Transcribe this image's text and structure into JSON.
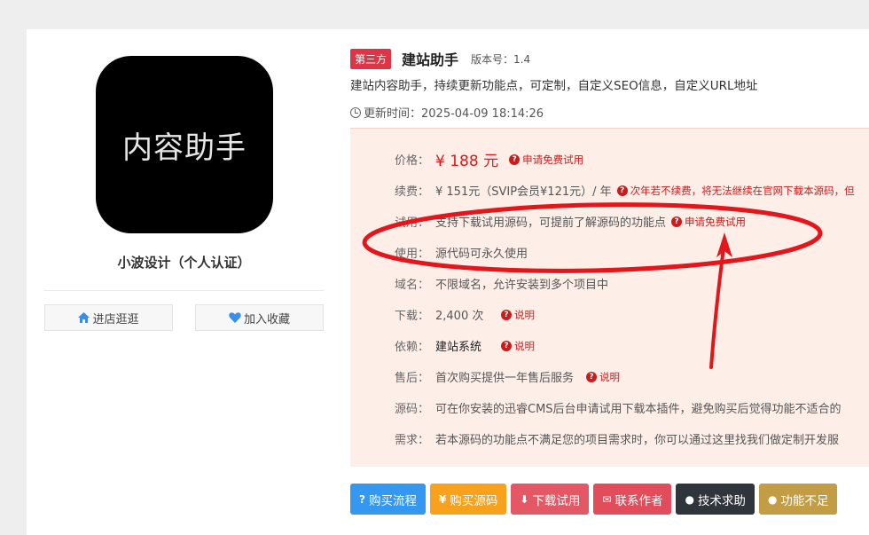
{
  "sidebar": {
    "logo_text": "内容助手",
    "author": "小波设计（个人认证）",
    "buttons": {
      "shop": "进店逛逛",
      "favorite": "加入收藏"
    }
  },
  "header": {
    "badge": "第三方",
    "title": "建站助手",
    "version": "版本号：1.4",
    "description": "建站内容助手，持续更新功能点，可定制，自定义SEO信息，自定义URL地址",
    "update_time": "更新时间：2025-04-09 18:14:26"
  },
  "info": {
    "price": {
      "label": "价格：",
      "value": "¥ 188 元",
      "tip": "申请免费试用"
    },
    "renewal": {
      "label": "续费：",
      "value": "¥ 151元（SVIP会员¥121元）/ 年",
      "tip": "次年若不续费，将无法继续在官网下载本源码，但"
    },
    "trial": {
      "label": "试用：",
      "value": "支持下载试用源码，可提前了解源码的功能点",
      "tip": "申请免费试用"
    },
    "usage": {
      "label": "使用：",
      "value": "源代码可永久使用"
    },
    "domain": {
      "label": "域名：",
      "value": "不限域名，允许安装到多个项目中"
    },
    "downloads": {
      "label": "下载：",
      "value": "2,400 次",
      "tip": "说明"
    },
    "depends": {
      "label": "依赖：",
      "value": "建站系统",
      "tip": "说明"
    },
    "aftersale": {
      "label": "售后：",
      "value": "首次购买提供一年售后服务",
      "tip": "说明"
    },
    "source": {
      "label": "源码：",
      "value": "可在你安装的迅睿CMS后台申请试用下载本插件，避免购买后觉得功能不适合的"
    },
    "demand": {
      "label": "需求：",
      "value": "若本源码的功能点不满足您的项目需求时，你可以通过这里找我们做定制开发服"
    }
  },
  "actions": [
    {
      "label": "购买流程",
      "icon": "?",
      "color": "#3598f0"
    },
    {
      "label": "购买源码",
      "icon": "¥",
      "color": "#f7a11c"
    },
    {
      "label": "下载试用",
      "icon": "⬇",
      "color": "#e45865"
    },
    {
      "label": "联系作者",
      "icon": "✉",
      "color": "#e34d5b"
    },
    {
      "label": "技术求助",
      "icon": "●",
      "color": "#2f353b"
    },
    {
      "label": "功能不足",
      "icon": "●",
      "color": "#c29d45"
    }
  ],
  "annotation": {
    "color": "#e3161b"
  }
}
